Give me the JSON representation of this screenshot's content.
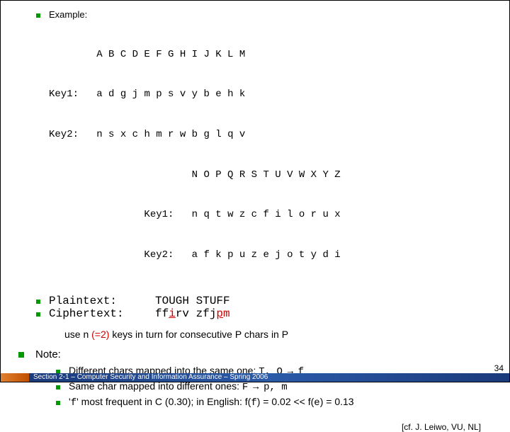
{
  "example_label": "Example:",
  "alpha_row1": "A B C D E F G H I J K L M",
  "key1_label": "Key1:",
  "key1_row1": "a d g j m p s v y b e h k",
  "key2_label": "Key2:",
  "key2_row1": "n s x c h m r w b g l q v",
  "alpha_row2": "N O P Q R S T U V W X Y Z",
  "key1_row2": "n q t w z c f i l o r u x",
  "key2_row2": "a f k p u z e j o t y d i",
  "plaintext_label": "Plaintext:",
  "plaintext_value": "TOUGH STUFF",
  "ciphertext_label": "Ciphertext:",
  "cipher_pre": "ff",
  "cipher_i": "i",
  "cipher_mid": "rv zfj",
  "cipher_p": "p",
  "cipher_m": "m",
  "use_n_pre": "use n ",
  "use_n_paren": "(=2) ",
  "use_n_post": "keys in turn for consecutive P chars in P",
  "note_label": "Note:",
  "note1_pre": "Different chars mapped into the same one: ",
  "note1_to": "T, O",
  "note1_arrow": " → ",
  "note1_f": "f",
  "note2_pre": "Same char mapped into different ones: ",
  "note2_F": "F",
  "note2_arrow": " → ",
  "note2_pm": "p, m",
  "note3_a": "'",
  "note3_f1": "f",
  "note3_b": "' most frequent in C (0.30); in English: f(",
  "note3_f2": "f",
  "note3_c": ") = 0.02 << f(",
  "note3_e": "e",
  "note3_d": ") = 0.13",
  "cite": "[cf. J. Leiwo, VU, NL]",
  "footer_text": "Section 2-1 – Computer Security and Information Assurance – Spring 2006",
  "page_number": "34"
}
